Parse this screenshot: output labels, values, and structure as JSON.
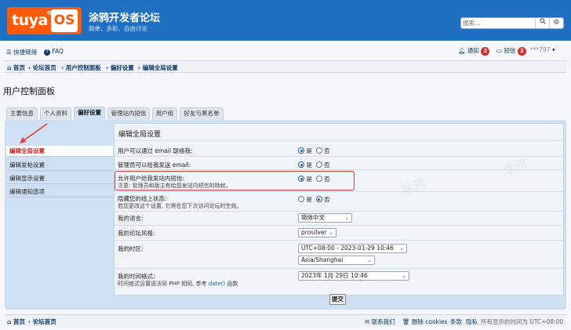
{
  "header": {
    "logo_tuya": "tuya",
    "logo_os": "OS",
    "site_title": "涂鸦开发者论坛",
    "site_subtitle": "简单、多彩、自由讨论",
    "search_placeholder": "搜索…",
    "search_icon": "search-icon",
    "settings_icon": "gear-icon"
  },
  "topnav": {
    "quicklinks": "快捷链接",
    "faq": "FAQ",
    "notifications": "通知",
    "notifications_count": "2",
    "messages": "短信",
    "messages_count": "2",
    "user": "***797"
  },
  "breadcrumb": [
    "首页",
    "论坛首页",
    "用户控制面板",
    "偏好设置",
    "编辑全局设置"
  ],
  "page_title": "用户控制面板",
  "tabs": [
    {
      "label": "主要信息"
    },
    {
      "label": "个人资料"
    },
    {
      "label": "偏好设置",
      "active": true
    },
    {
      "label": "管理站内短信"
    },
    {
      "label": "用户组"
    },
    {
      "label": "好友与黑名单"
    }
  ],
  "sidebar": [
    {
      "label": "编辑全局设置",
      "active": true
    },
    {
      "label": "编辑发帖设置"
    },
    {
      "label": "编辑显示设置"
    },
    {
      "label": "编辑通知选项"
    }
  ],
  "content": {
    "title": "编辑全局设置",
    "rows": [
      {
        "label": "用户可以通过 email 联络我:",
        "yes": "是",
        "no": "否",
        "value": "yes"
      },
      {
        "label": "管理员可以给我发送 email:",
        "yes": "是",
        "no": "否",
        "value": "yes"
      },
      {
        "label": "允许用户给我发站内短信:",
        "note": "注意: 管理员和版主有给您发站内短信的特权。",
        "yes": "是",
        "no": "否",
        "value": "yes"
      },
      {
        "label": "隐藏您的线上状态:",
        "note": "若您更改这个设置, 它将在您下次访问论坛时生效。",
        "yes": "是",
        "no": "否",
        "value": "no"
      }
    ],
    "language_label": "我的语言:",
    "language_value": "简体中文",
    "style_label": "我的论坛风格:",
    "style_value": "prosilver",
    "timezone_label": "我的时区:",
    "timezone_value": "UTC+08:00 - 2023-01-29 10:46",
    "timezone_city": "Asia/Shanghai",
    "dateformat_label": "我的时间格式:",
    "dateformat_note_a": "时间格式设置语法同 PHP 相同, 参考",
    "dateformat_note_link": "date()",
    "dateformat_note_b": "函数",
    "dateformat_value": "2023年 1月 29日 10:46",
    "submit": "提交"
  },
  "footer": {
    "home": "首页",
    "forum_home": "论坛首页",
    "contact": "联系我们",
    "delete_cookies": "删除 cookies",
    "terms": "条款",
    "privacy": "隐私",
    "timezone_note": "所有显示的时间为 UTC+08:00"
  },
  "watermark": "涂鸦",
  "colors": {
    "header_bg": "#1f6fc2",
    "logo_orange": "#ff5a0a",
    "badge_red": "#d62d2d",
    "active_red": "#d0261f",
    "panel_bg": "#cfe0f2"
  }
}
